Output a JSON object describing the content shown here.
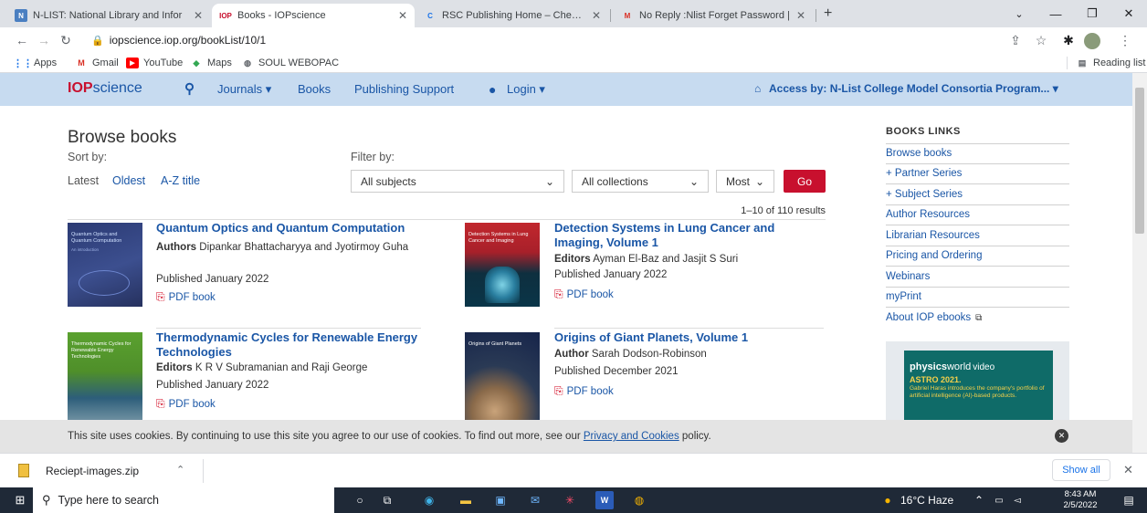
{
  "browser": {
    "tabs": [
      {
        "title": "N-LIST: National Library and Infor",
        "favicon": "N"
      },
      {
        "title": "Books - IOPscience",
        "favicon": "IOP"
      },
      {
        "title": "RSC Publishing Home – Chemical",
        "favicon": "C"
      },
      {
        "title": "No Reply :Nlist Forget Password |",
        "favicon": "M"
      }
    ],
    "url": "iopscience.iop.org/bookList/10/1",
    "bookmarks": [
      "Apps",
      "Gmail",
      "YouTube",
      "Maps",
      "SOUL WEBOPAC"
    ],
    "reading_list": "Reading list"
  },
  "site": {
    "logo_iop": "IOP",
    "logo_science": "science",
    "nav": {
      "journals": "Journals ▾",
      "books": "Books",
      "publishing_support": "Publishing Support",
      "login": "Login ▾"
    },
    "access": "Access by: N-List College Model Consortia Program... ▾"
  },
  "browse": {
    "title": "Browse books",
    "sort_label": "Sort by:",
    "sort_options": [
      "Latest",
      "Oldest",
      "A-Z title"
    ],
    "filter_label": "Filter by:",
    "subjects": "All subjects",
    "collections": "All collections",
    "most": "Most",
    "go": "Go",
    "results": "1–10 of 110 results"
  },
  "books": [
    {
      "title": "Quantum Optics and Quantum Computation",
      "role": "Authors",
      "people": "Dipankar Bhattacharyya and Jyotirmoy Guha",
      "published": "Published January 2022",
      "pdf": "PDF book",
      "cover_text": "Quantum Optics and Quantum Computation",
      "cover_sub": "An introduction"
    },
    {
      "title": "Detection Systems in Lung Cancer and Imaging, Volume 1",
      "role": "Editors",
      "people": "Ayman El-Baz and Jasjit S Suri",
      "published": "Published January 2022",
      "pdf": "PDF book",
      "cover_text": "Detection Systems in Lung Cancer and Imaging"
    },
    {
      "title": "Thermodynamic Cycles for Renewable Energy Technologies",
      "role": "Editors",
      "people": "K R V Subramanian and Raji George",
      "published": "Published January 2022",
      "pdf": "PDF book",
      "cover_text": "Thermodynamic Cycles for Renewable Energy Technologies"
    },
    {
      "title": "Origins of Giant Planets, Volume 1",
      "role": "Author",
      "people": "Sarah Dodson-Robinson",
      "published": "Published December 2021",
      "pdf": "PDF book",
      "cover_text": "Origins of Giant Planets"
    }
  ],
  "sidebar": {
    "title": "BOOKS LINKS",
    "items": [
      "Browse books",
      "+ Partner Series",
      "+ Subject Series",
      "Author Resources",
      "Librarian Resources",
      "Pricing and Ordering",
      "Webinars",
      "myPrint",
      "About IOP ebooks"
    ],
    "ad": {
      "brand_physics": "physics",
      "brand_world": "world",
      "brand_video": "video",
      "headline": "ASTRO 2021.",
      "body": "Gabriel Haras introduces the company's portfolio of artificial intelligence (AI)-based products."
    }
  },
  "cookie": {
    "text": "This site uses cookies. By continuing to use this site you agree to our use of cookies. To find out more, see our ",
    "link": "Privacy and Cookies",
    "end": " policy."
  },
  "download": {
    "file": "Reciept-images.zip",
    "show_all": "Show all"
  },
  "taskbar": {
    "search": "Type here to search",
    "weather": "16°C Haze",
    "time": "8:43 AM",
    "date": "2/5/2022"
  }
}
